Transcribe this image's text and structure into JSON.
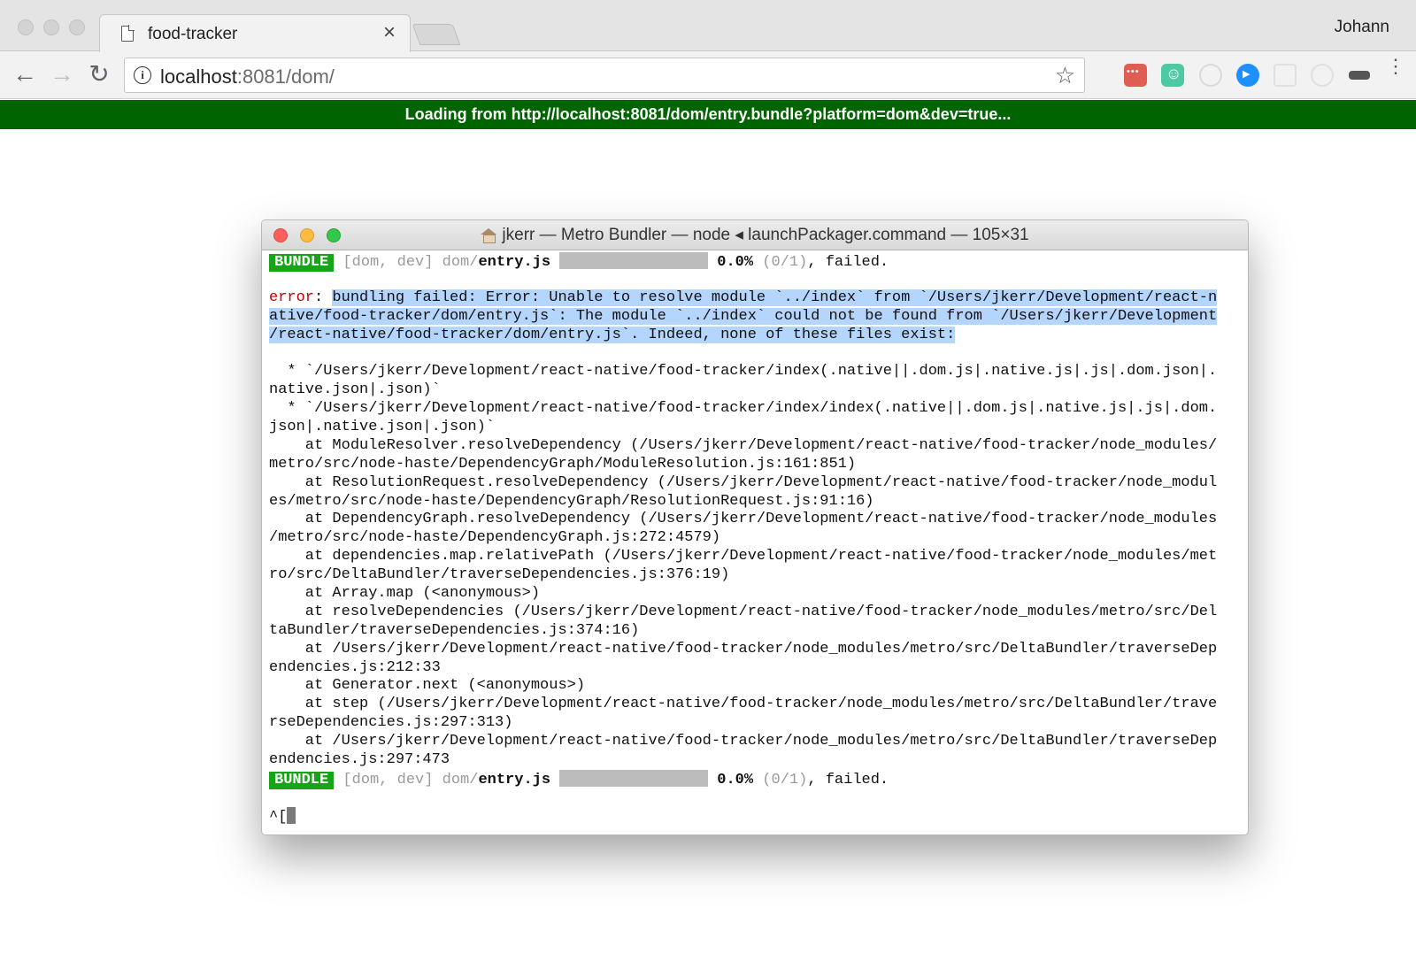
{
  "browser": {
    "tab_title": "food-tracker",
    "tab_close": "×",
    "profile_name": "Johann",
    "url_host": "localhost",
    "url_rest": ":8081/dom/",
    "back_glyph": "←",
    "forward_glyph": "→",
    "reload_glyph": "↻",
    "info_glyph": "i",
    "star_glyph": "☆",
    "menu_glyph": "⋮",
    "extensions": [
      "red-chat-extension-icon",
      "green-smiley-extension-icon",
      "gray-circle-extension-icon",
      "blue-video-extension-icon",
      "gray-gear-extension-icon",
      "gray-moon-extension-icon",
      "mask-extension-icon"
    ]
  },
  "banner": {
    "text": "Loading from http://localhost:8081/dom/entry.bundle?platform=dom&dev=true..."
  },
  "terminal": {
    "title": "jkerr — Metro Bundler — node ◂ launchPackager.command — 105×31",
    "bundle_badge": "BUNDLE",
    "bundle_tags": " [dom, dev] dom/",
    "bundle_file": "entry.js",
    "bundle_percent": "0.0%",
    "bundle_count": " (0/1)",
    "bundle_status": ", failed.",
    "error_label": "error",
    "error_sep": ": ",
    "error_lines": [
      "bundling failed: Error: Unable to resolve module `../index` from `/Users/jkerr/Development/react-n",
      "ative/food-tracker/dom/entry.js`: The module `../index` could not be found from `/Users/jkerr/Development",
      "/react-native/food-tracker/dom/entry.js`. Indeed, none of these files exist:"
    ],
    "detail_lines": [
      "  * `/Users/jkerr/Development/react-native/food-tracker/index(.native||.dom.js|.native.js|.js|.dom.json|.",
      "native.json|.json)`",
      "  * `/Users/jkerr/Development/react-native/food-tracker/index/index(.native||.dom.js|.native.js|.js|.dom.",
      "json|.native.json|.json)`",
      "    at ModuleResolver.resolveDependency (/Users/jkerr/Development/react-native/food-tracker/node_modules/",
      "metro/src/node-haste/DependencyGraph/ModuleResolution.js:161:851)",
      "    at ResolutionRequest.resolveDependency (/Users/jkerr/Development/react-native/food-tracker/node_modul",
      "es/metro/src/node-haste/DependencyGraph/ResolutionRequest.js:91:16)",
      "    at DependencyGraph.resolveDependency (/Users/jkerr/Development/react-native/food-tracker/node_modules",
      "/metro/src/node-haste/DependencyGraph.js:272:4579)",
      "    at dependencies.map.relativePath (/Users/jkerr/Development/react-native/food-tracker/node_modules/met",
      "ro/src/DeltaBundler/traverseDependencies.js:376:19)",
      "    at Array.map (<anonymous>)",
      "    at resolveDependencies (/Users/jkerr/Development/react-native/food-tracker/node_modules/metro/src/Del",
      "taBundler/traverseDependencies.js:374:16)",
      "    at /Users/jkerr/Development/react-native/food-tracker/node_modules/metro/src/DeltaBundler/traverseDep",
      "endencies.js:212:33",
      "    at Generator.next (<anonymous>)",
      "    at step (/Users/jkerr/Development/react-native/food-tracker/node_modules/metro/src/DeltaBundler/trave",
      "rseDependencies.js:297:313)",
      "    at /Users/jkerr/Development/react-native/food-tracker/node_modules/metro/src/DeltaBundler/traverseDep",
      "endencies.js:297:473"
    ],
    "prompt": "^["
  }
}
